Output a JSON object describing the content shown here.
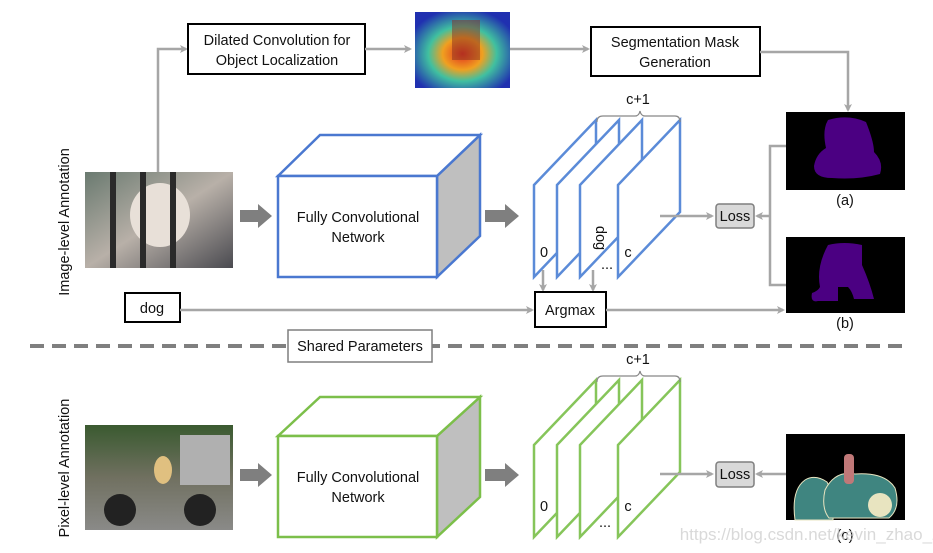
{
  "top": {
    "dilated_box": [
      "Dilated Convolution for",
      "Object Localization"
    ],
    "seg_box": [
      "Segmentation Mask",
      "Generation"
    ],
    "fcn": [
      "Fully Convolutional",
      "Network"
    ],
    "brace_label": "c+1",
    "plane_labels": {
      "first": "0",
      "dog": "dog",
      "ellipsis": "...",
      "last": "c"
    },
    "loss": "Loss",
    "dog_input": "dog",
    "argmax": "Argmax",
    "mask_a": "(a)",
    "mask_b": "(b)",
    "side_label": "Image-level Annotation",
    "cube_color": "#4a78d0"
  },
  "shared": "Shared Parameters",
  "bottom": {
    "fcn": [
      "Fully Convolutional",
      "Network"
    ],
    "brace_label": "c+1",
    "plane_labels": {
      "first": "0",
      "ellipsis": "...",
      "last": "c"
    },
    "loss": "Loss",
    "mask_c": "(c)",
    "side_label": "Pixel-level Annotation",
    "cube_color": "#7cbf4a"
  },
  "watermark": "https://blog.csdn.net/kevin_zhao_zl"
}
